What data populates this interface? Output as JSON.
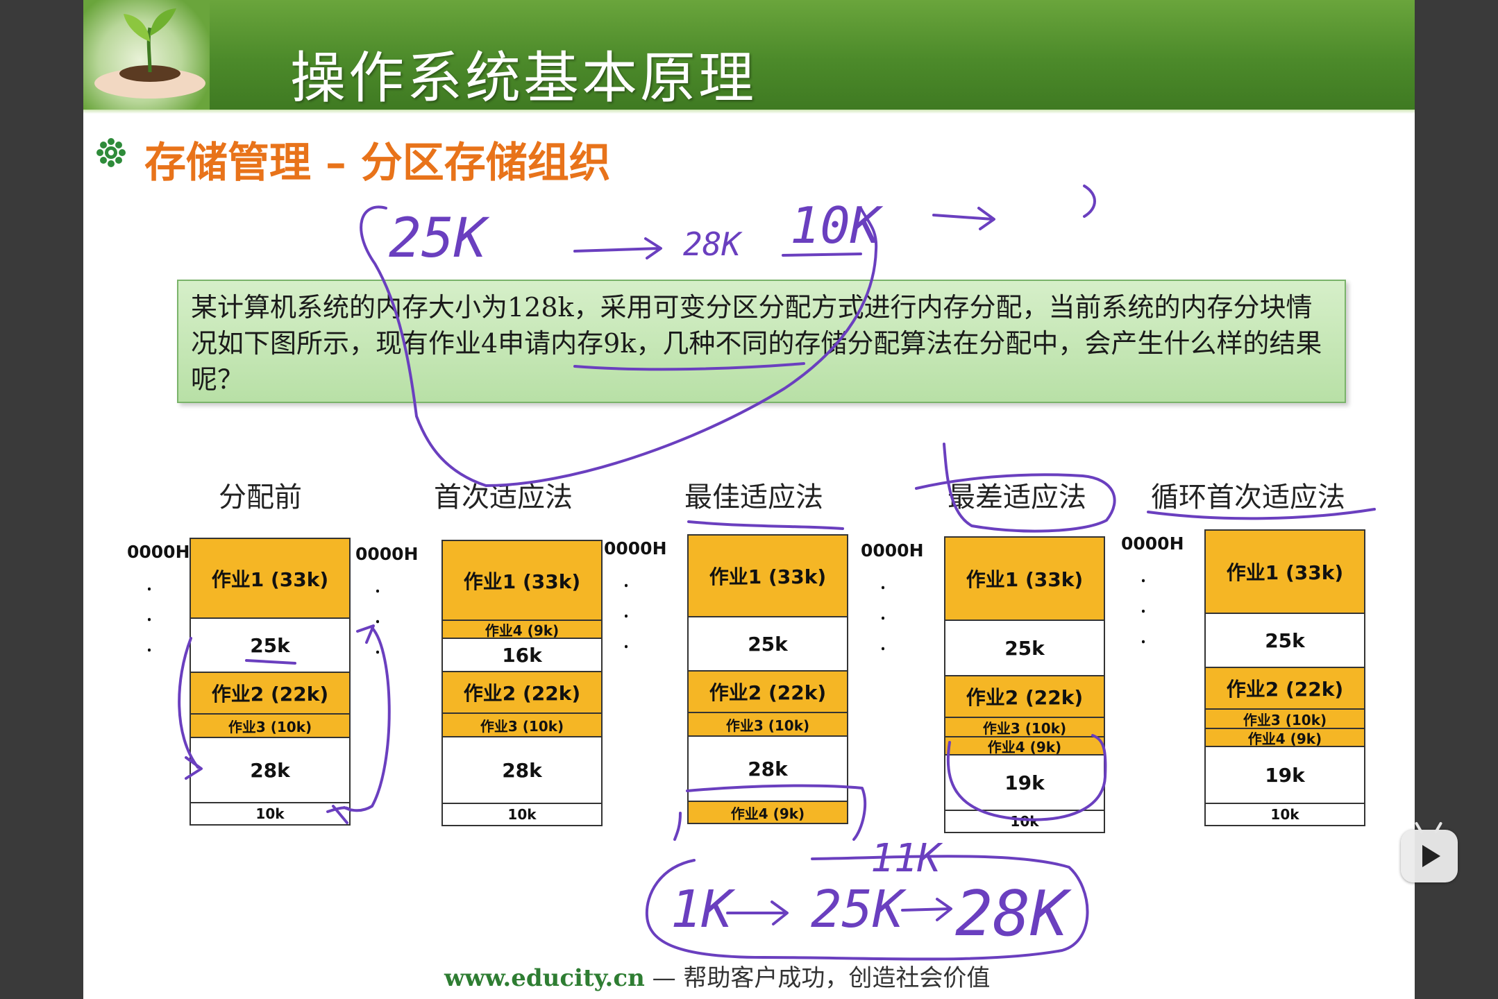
{
  "slide": {
    "title": "操作系统基本原理",
    "subtitle": "存储管理 – 分区存储组织",
    "question": "某计算机系统的内存大小为128k，采用可变分区分配方式进行内存分配，当前系统的内存分块情况如下图所示，现有作业4申请内存9k，几种不同的存储分配算法在分配中，会产生什么样的结果呢？",
    "footer_url": "www.educity.cn",
    "footer_sep": " — ",
    "footer_slogan": "帮助客户成功，创造社会价值"
  },
  "address_label": "0000H",
  "columns": [
    {
      "title": "分配前",
      "blocks": [
        {
          "label": "作业1 (33k)",
          "kind": "job"
        },
        {
          "label": "25k",
          "kind": "free"
        },
        {
          "label": "作业2 (22k)",
          "kind": "job"
        },
        {
          "label": "作业3 (10k)",
          "kind": "job"
        },
        {
          "label": "28k",
          "kind": "free"
        },
        {
          "label": "10k",
          "kind": "free"
        }
      ]
    },
    {
      "title": "首次适应法",
      "blocks": [
        {
          "label": "作业1 (33k)",
          "kind": "job"
        },
        {
          "label": "作业4 (9k)",
          "kind": "job"
        },
        {
          "label": "16k",
          "kind": "free"
        },
        {
          "label": "作业2 (22k)",
          "kind": "job"
        },
        {
          "label": "作业3 (10k)",
          "kind": "job"
        },
        {
          "label": "28k",
          "kind": "free"
        },
        {
          "label": "10k",
          "kind": "free"
        }
      ]
    },
    {
      "title": "最佳适应法",
      "blocks": [
        {
          "label": "作业1 (33k)",
          "kind": "job"
        },
        {
          "label": "25k",
          "kind": "free"
        },
        {
          "label": "作业2 (22k)",
          "kind": "job"
        },
        {
          "label": "作业3 (10k)",
          "kind": "job"
        },
        {
          "label": "28k",
          "kind": "free"
        },
        {
          "label": "作业4 (9k)",
          "kind": "job"
        }
      ]
    },
    {
      "title": "最差适应法",
      "blocks": [
        {
          "label": "作业1 (33k)",
          "kind": "job"
        },
        {
          "label": "25k",
          "kind": "free"
        },
        {
          "label": "作业2 (22k)",
          "kind": "job"
        },
        {
          "label": "作业3 (10k)",
          "kind": "job"
        },
        {
          "label": "作业4 (9k)",
          "kind": "job"
        },
        {
          "label": "19k",
          "kind": "free"
        },
        {
          "label": "10k",
          "kind": "free"
        }
      ]
    },
    {
      "title": "循环首次适应法",
      "blocks": [
        {
          "label": "作业1 (33k)",
          "kind": "job"
        },
        {
          "label": "25k",
          "kind": "free"
        },
        {
          "label": "作业2 (22k)",
          "kind": "job"
        },
        {
          "label": "作业3 (10k)",
          "kind": "job"
        },
        {
          "label": "作业4 (9k)",
          "kind": "job"
        },
        {
          "label": "19k",
          "kind": "free"
        },
        {
          "label": "10k",
          "kind": "free"
        }
      ]
    }
  ],
  "annotations": {
    "top_25k": "25K",
    "top_28k": "28K",
    "top_10k": "10K",
    "bottom_11k": "11K",
    "bottom_seq_1": "1K",
    "bottom_seq_2": "25K",
    "bottom_seq_3": "28K",
    "bottom_arrow": "→"
  },
  "colors": {
    "job_fill": "#f5b625",
    "header_green": "#4c8a2a",
    "subtitle_orange": "#e8731a",
    "ink_purple": "#6a3fbf"
  }
}
